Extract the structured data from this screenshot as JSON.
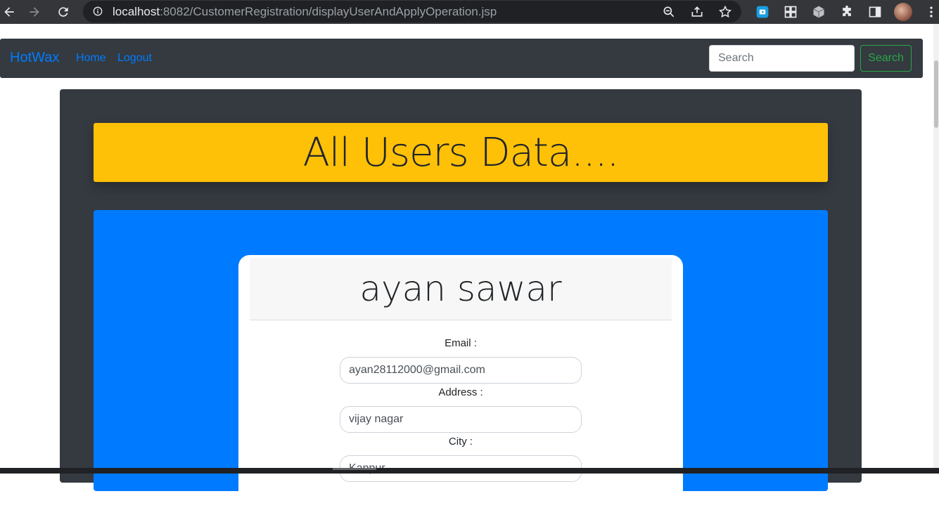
{
  "browser": {
    "url_host": "localhost",
    "url_rest": ":8082/CustomerRegistration/displayUserAndApplyOperation.jsp"
  },
  "navbar": {
    "brand": "HotWax",
    "links": [
      "Home",
      "Logout"
    ],
    "search_placeholder": "Search",
    "search_button": "Search"
  },
  "page": {
    "heading": "All Users Data....",
    "user_card": {
      "name": "ayan sawar",
      "fields": [
        {
          "label": "Email :",
          "value": "ayan28112000@gmail.com"
        },
        {
          "label": "Address :",
          "value": "vijay nagar"
        },
        {
          "label": "City :",
          "value": "Kanpur"
        }
      ]
    }
  },
  "colors": {
    "navbar_bg": "#343a40",
    "brand": "#007bff",
    "heading_bg": "#ffc107",
    "card_container_bg": "#007bff",
    "search_button": "#28a745"
  }
}
